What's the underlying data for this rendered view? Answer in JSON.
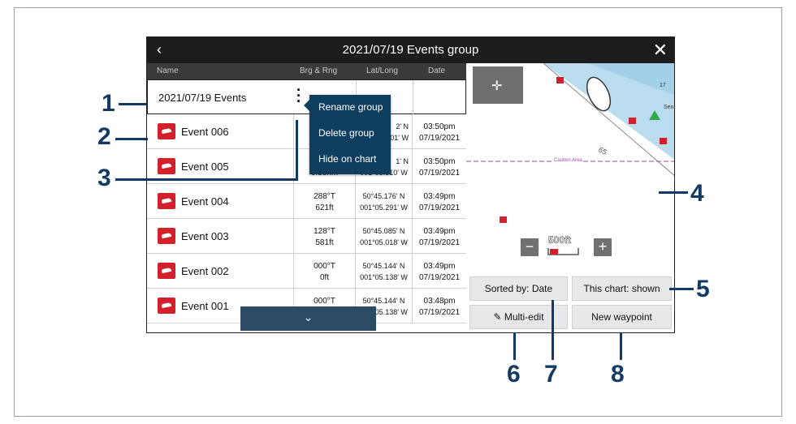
{
  "header": {
    "title": "2021/07/19 Events group",
    "back_icon": "‹",
    "close_icon": "✕"
  },
  "columns": {
    "name": "Name",
    "brg": "Brg & Rng",
    "latlong": "Lat/Long",
    "date": "Date"
  },
  "group_row": {
    "name": "2021/07/19 Events"
  },
  "context_menu": {
    "items": [
      "Rename group",
      "Delete group",
      "Hide on chart"
    ]
  },
  "rows": [
    {
      "name": "Event 006",
      "brg": "",
      "rng": "",
      "lat": "2' N",
      "lon": "01' W",
      "time": "03:50pm",
      "date": "07/19/2021"
    },
    {
      "name": "Event 005",
      "brg": "",
      "rng": "0.38nm",
      "lat": "1' N",
      "lon": "001°05.510' W",
      "time": "03:50pm",
      "date": "07/19/2021"
    },
    {
      "name": "Event 004",
      "brg": "288°T",
      "rng": "621ft",
      "lat": "50°45.176' N",
      "lon": "001°05.291' W",
      "time": "03:49pm",
      "date": "07/19/2021"
    },
    {
      "name": "Event 003",
      "brg": "128°T",
      "rng": "581ft",
      "lat": "50°45.085' N",
      "lon": "001°05.018' W",
      "time": "03:49pm",
      "date": "07/19/2021"
    },
    {
      "name": "Event 002",
      "brg": "000°T",
      "rng": "0ft",
      "lat": "50°45.144' N",
      "lon": "001°05.138' W",
      "time": "03:49pm",
      "date": "07/19/2021"
    },
    {
      "name": "Event 001",
      "brg": "000°T",
      "rng": "",
      "lat": "50°45.144' N",
      "lon": "001°05.138' W",
      "time": "03:48pm",
      "date": "07/19/2021"
    }
  ],
  "scroll": {
    "label": "⌄"
  },
  "chart": {
    "scale_label": "500ft",
    "depth_label": "65",
    "caution_label": "Caution Area",
    "top_label": "17",
    "side_label": "Sen",
    "zoom_out": "−",
    "zoom_in": "+"
  },
  "buttons": {
    "sort": "Sorted by: Date",
    "chart_shown": "This chart: shown",
    "multi_edit": "Multi-edit",
    "new_waypoint": "New waypoint"
  },
  "callouts": [
    "1",
    "2",
    "3",
    "4",
    "5",
    "6",
    "7",
    "8"
  ],
  "colors": {
    "accent": "#133a63",
    "menu": "#0f3d5e",
    "icon_red": "#d4202a"
  }
}
